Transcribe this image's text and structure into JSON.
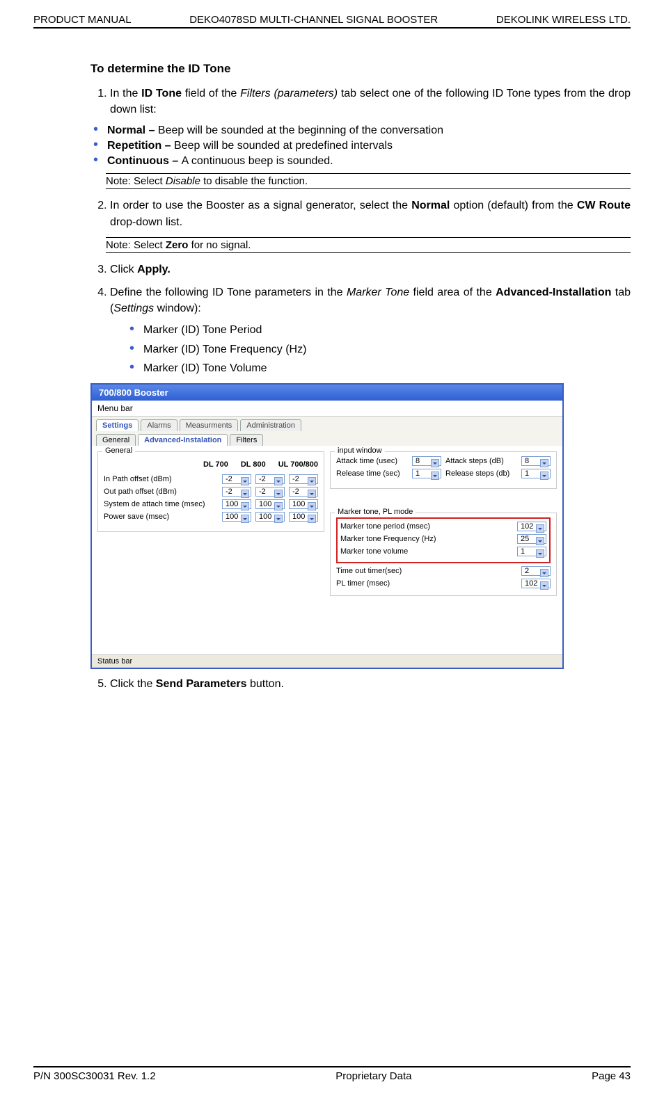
{
  "header": {
    "left": "PRODUCT MANUAL",
    "center": "DEKO4078SD MULTI-CHANNEL SIGNAL BOOSTER",
    "right": "DEKOLINK WIRELESS LTD."
  },
  "section_title": "To determine the ID Tone",
  "step1": {
    "prefix": "In the ",
    "bold1": "ID Tone",
    "mid": " field of the ",
    "italic": "Filters (parameters)",
    "suffix": " tab select one of the following ID Tone types from the drop down list:"
  },
  "bullets1": {
    "normal_b": "Normal – ",
    "normal_t": "Beep will be sounded at the beginning of the conversation",
    "rep_b": "Repetition – ",
    "rep_t": "Beep will be sounded at predefined intervals",
    "cont_b": "Continuous – ",
    "cont_t": "A continuous beep is sounded."
  },
  "note1": {
    "prefix": "Note: Select ",
    "italic": "Disable",
    "suffix": " to disable the function."
  },
  "step2": {
    "prefix": "In order to use the Booster as a signal generator, select the ",
    "bold": "Normal",
    "mid": " option (default) from the ",
    "bold2": "CW Route",
    "suffix": " drop-down list."
  },
  "note2": {
    "prefix": "Note: Select ",
    "bold": "Zero",
    "suffix": " for no signal."
  },
  "step3": {
    "prefix": "Click ",
    "bold": "Apply."
  },
  "step4": {
    "prefix": "Define the following ID Tone parameters in the ",
    "italic1": "Marker Tone",
    "mid": " field area of the ",
    "bold": "Advanced-Installation",
    "mid2": " tab (",
    "italic2": "Settings",
    "suffix": " window):"
  },
  "bullets2": {
    "b1": "Marker (ID) Tone Period",
    "b2": "Marker (ID) Tone Frequency (Hz)",
    "b3": "Marker (ID) Tone Volume"
  },
  "step5": {
    "prefix": "Click the ",
    "bold": "Send Parameters",
    "suffix": " button."
  },
  "screenshot": {
    "title": "700/800 Booster",
    "menubar": "Menu bar",
    "tabs": {
      "settings": "Settings",
      "alarms": "Alarms",
      "meas": "Measurments",
      "admin": "Administration"
    },
    "subtabs": {
      "general": "General",
      "adv": "Advanced-Instalation",
      "filters": "Filters"
    },
    "left_fieldset": "General",
    "cols": {
      "c1": "DL 700",
      "c2": "DL 800",
      "c3": "UL 700/800"
    },
    "rows": {
      "r1": {
        "label": "In Path offset  (dBm)",
        "v1": "-2",
        "v2": "-2",
        "v3": "-2"
      },
      "r2": {
        "label": "Out path offset (dBm)",
        "v1": "-2",
        "v2": "-2",
        "v3": "-2"
      },
      "r3": {
        "label": "System de attach time (msec)",
        "v1": "100",
        "v2": "100",
        "v3": "100"
      },
      "r4": {
        "label": "Power save (msec)",
        "v1": "100",
        "v2": "100",
        "v3": "100"
      }
    },
    "input_window": "input window",
    "iw": {
      "attack_time": "Attack time (usec)",
      "attack_time_v": "8",
      "attack_steps": "Attack steps (dB)",
      "attack_steps_v": "8",
      "release_time": "Release time (sec)",
      "release_time_v": "1",
      "release_steps": "Release steps (db)",
      "release_steps_v": "1"
    },
    "marker_title": "Marker tone, PL mode",
    "marker": {
      "m1": "Marker tone period (msec)",
      "m1v": "102",
      "m2": "Marker tone Frequency (Hz)",
      "m2v": "25",
      "m3": "Marker tone volume",
      "m3v": "1",
      "m4": "Time out timer(sec)",
      "m4v": "2",
      "m5": "PL timer (msec)",
      "m5v": "102"
    },
    "statusbar": "Status bar"
  },
  "footer": {
    "left": "P/N 300SC30031 Rev. 1.2",
    "center": "Proprietary Data",
    "right": "Page 43"
  }
}
